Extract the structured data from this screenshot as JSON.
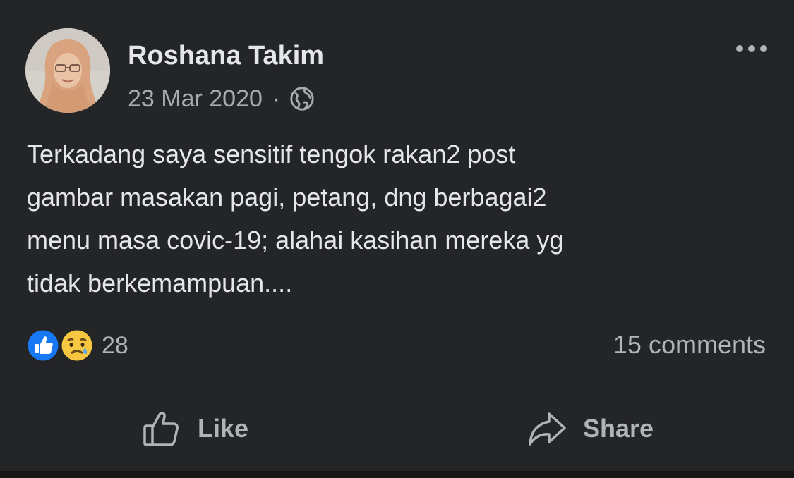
{
  "post": {
    "author": "Roshana Takim",
    "date": "23 Mar 2020",
    "separator": "·",
    "visibility_icon": "globe-icon",
    "more_icon": "more-horizontal-icon",
    "text_lines": [
      "Terkadang saya sensitif tengok rakan2 post",
      "gambar masakan pagi, petang, dng berbagai2",
      "menu masa covic-19; alahai kasihan mereka yg",
      "tidak berkemampuan...."
    ],
    "reactions": {
      "icons": [
        "like-reaction-icon",
        "sad-reaction-icon"
      ],
      "count": "28"
    },
    "comments": "15 comments"
  },
  "actions": {
    "like_label": "Like",
    "like_icon": "thumbs-up-icon",
    "share_label": "Share",
    "share_icon": "share-arrow-icon"
  },
  "colors": {
    "background": "#242526",
    "primary_text": "#e4e6eb",
    "secondary_text": "#b0b3b8",
    "divider": "#3e4042",
    "like_blue": "#1877f2",
    "sad_yellow": "#f7c741"
  }
}
